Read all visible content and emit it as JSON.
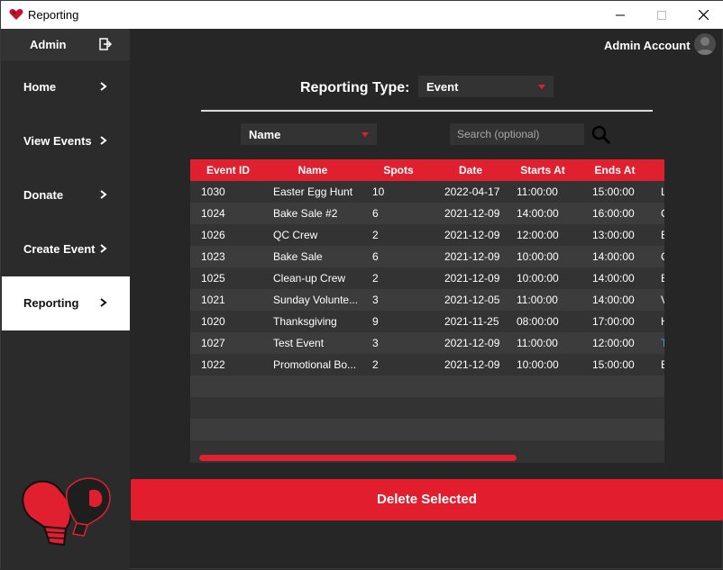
{
  "window": {
    "title": "Reporting",
    "icons": {
      "app": "heart-glove-icon",
      "minimize": "minimize-icon",
      "maximize": "maximize-icon",
      "close": "close-icon"
    }
  },
  "sidebar": {
    "header_label": "Admin",
    "logout_icon": "logout-icon",
    "items": [
      {
        "label": "Home",
        "arrow": "chevron-right-icon"
      },
      {
        "label": "View Events",
        "arrow": "chevron-right-icon"
      },
      {
        "label": "Donate",
        "arrow": "chevron-right-icon"
      },
      {
        "label": "Create Event",
        "arrow": "chevron-right-icon"
      },
      {
        "label": "Reporting",
        "arrow": "chevron-right-icon",
        "active": true
      }
    ],
    "logo_icon": "boxing-gloves-heart-icon"
  },
  "header": {
    "account_name": "Admin Account",
    "avatar_icon": "user-avatar-icon"
  },
  "filters": {
    "reporting_type_label": "Reporting Type:",
    "reporting_type_value": "Event",
    "field_value": "Name",
    "search_placeholder": "Search (optional)",
    "search_value": "",
    "search_icon": "search-icon"
  },
  "table": {
    "columns": [
      "Event ID",
      "Name",
      "Spots",
      "Date",
      "Starts At",
      "Ends At"
    ],
    "rows": [
      [
        "1030",
        "Easter Egg Hunt",
        "10",
        "2022-04-17",
        "11:00:00",
        "15:00:00",
        "L"
      ],
      [
        "1024",
        "Bake Sale #2",
        "6",
        "2021-12-09",
        "14:00:00",
        "16:00:00",
        "C"
      ],
      [
        "1026",
        "QC Crew",
        "2",
        "2021-12-09",
        "12:00:00",
        "13:00:00",
        "E"
      ],
      [
        "1023",
        "Bake Sale",
        "6",
        "2021-12-09",
        "10:00:00",
        "14:00:00",
        "C"
      ],
      [
        "1025",
        "Clean-up Crew",
        "2",
        "2021-12-09",
        "10:00:00",
        "14:00:00",
        "E"
      ],
      [
        "1021",
        "Sunday Volunte...",
        "3",
        "2021-12-05",
        "11:00:00",
        "14:00:00",
        "V"
      ],
      [
        "1020",
        "Thanksgiving",
        "9",
        "2021-11-25",
        "08:00:00",
        "17:00:00",
        "H"
      ],
      [
        "1027",
        "Test Event",
        "3",
        "2021-12-09",
        "11:00:00",
        "12:00:00",
        "T"
      ],
      [
        "1022",
        "Promotional Bo...",
        "2",
        "2021-12-09",
        "10:00:00",
        "15:00:00",
        "E"
      ]
    ],
    "horizontal_scroll_fraction": 0.67
  },
  "actions": {
    "delete_label": "Delete Selected"
  },
  "colors": {
    "accent": "#e0202f",
    "background": "#262626",
    "sidebar": "#2b2b2b",
    "panel": "#333333"
  }
}
